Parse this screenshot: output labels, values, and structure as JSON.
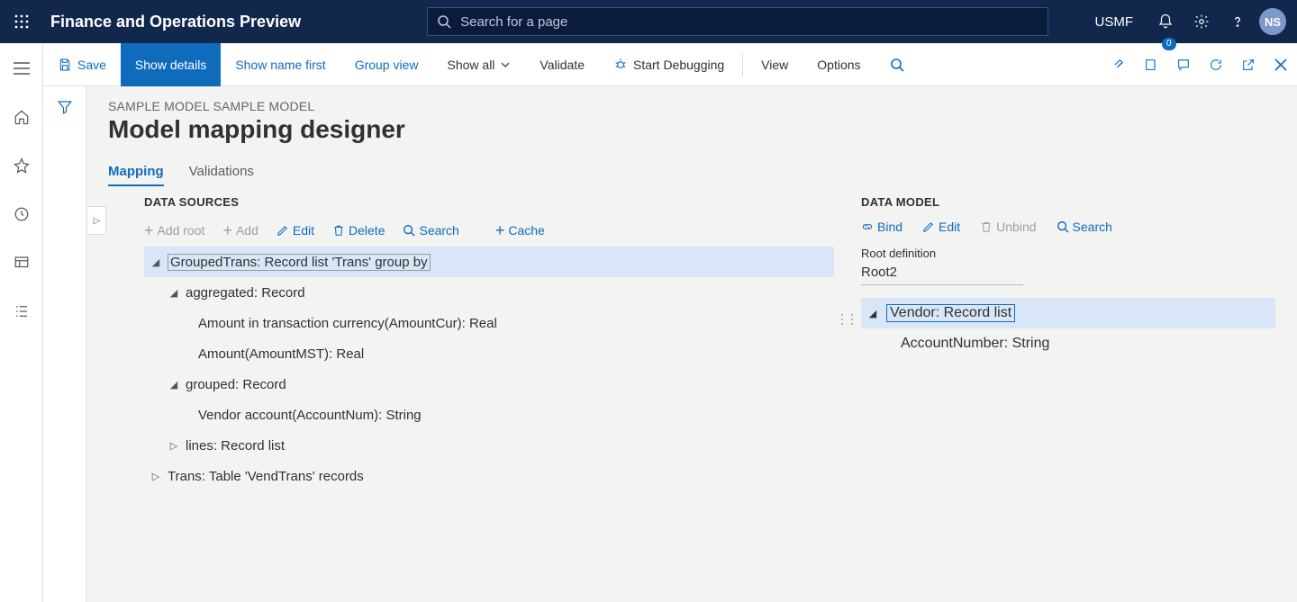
{
  "topbar": {
    "title": "Finance and Operations Preview",
    "search_placeholder": "Search for a page",
    "company": "USMF",
    "avatar": "NS"
  },
  "actionbar": {
    "save": "Save",
    "show_details": "Show details",
    "show_name_first": "Show name first",
    "group_view": "Group view",
    "show_all": "Show all",
    "validate": "Validate",
    "start_debugging": "Start Debugging",
    "view": "View",
    "options": "Options",
    "badge": "0"
  },
  "page": {
    "breadcrumb": "SAMPLE MODEL SAMPLE MODEL",
    "title": "Model mapping designer",
    "tabs": {
      "mapping": "Mapping",
      "validations": "Validations"
    }
  },
  "datasources": {
    "header": "DATA SOURCES",
    "actions": {
      "add_root": "Add root",
      "add": "Add",
      "edit": "Edit",
      "delete": "Delete",
      "search": "Search",
      "cache": "Cache"
    },
    "tree": {
      "n0": "GroupedTrans: Record list 'Trans' group by",
      "n1": "aggregated: Record",
      "n2": "Amount in transaction currency(AmountCur): Real",
      "n3": "Amount(AmountMST): Real",
      "n4": "grouped: Record",
      "n5": "Vendor account(AccountNum): String",
      "n6": "lines: Record list",
      "n7": "Trans: Table 'VendTrans' records"
    }
  },
  "datamodel": {
    "header": "DATA MODEL",
    "actions": {
      "bind": "Bind",
      "edit": "Edit",
      "unbind": "Unbind",
      "search": "Search"
    },
    "root_def_label": "Root definition",
    "root_def_value": "Root2",
    "tree": {
      "n0": "Vendor: Record list",
      "n1": "AccountNumber: String"
    }
  }
}
